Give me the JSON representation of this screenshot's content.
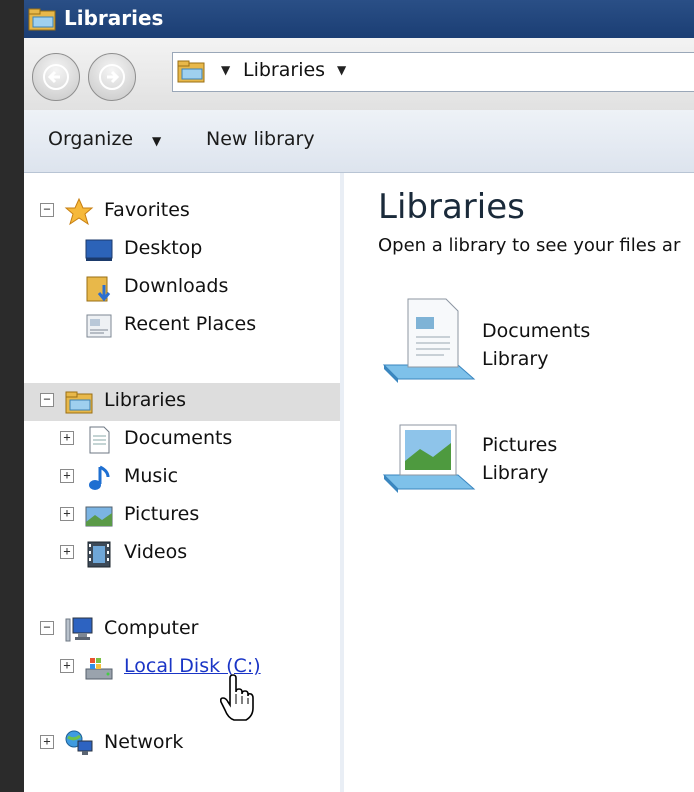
{
  "window": {
    "title": "Libraries"
  },
  "address_bar": {
    "path": "Libraries"
  },
  "toolbar": {
    "organize_label": "Organize",
    "new_library_label": "New library"
  },
  "nav_pane": {
    "favorites": {
      "label": "Favorites",
      "items": [
        "Desktop",
        "Downloads",
        "Recent Places"
      ]
    },
    "libraries": {
      "label": "Libraries",
      "items": [
        "Documents",
        "Music",
        "Pictures",
        "Videos"
      ]
    },
    "computer": {
      "label": "Computer",
      "items": [
        "Local Disk (C:)"
      ]
    },
    "network": {
      "label": "Network"
    }
  },
  "content": {
    "title": "Libraries",
    "subtitle": "Open a library to see your files ar",
    "libraries": [
      {
        "name": "Documents",
        "type": "Library"
      },
      {
        "name": "Pictures",
        "type": "Library"
      }
    ]
  },
  "icons": [
    "libraries-icon",
    "back-icon",
    "forward-icon",
    "star-icon",
    "desktop-icon",
    "downloads-icon",
    "recent-places-icon",
    "documents-icon",
    "music-icon",
    "pictures-icon",
    "videos-icon",
    "computer-icon",
    "local-disk-icon",
    "network-icon",
    "hand-cursor-icon"
  ],
  "colors": {
    "titlebar": "#1f4179",
    "link": "#1a35c6",
    "selected_row": "#dddddd"
  }
}
